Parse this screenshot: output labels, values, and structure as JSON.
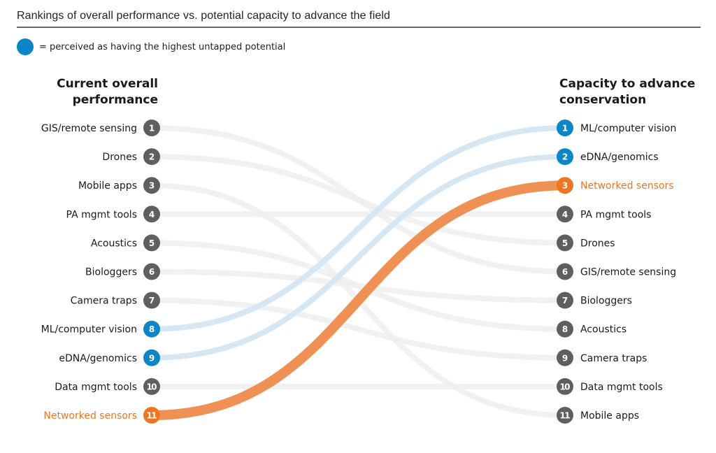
{
  "title": "Rankings of overall performance vs. potential capacity to advance the field",
  "legend": {
    "marker_color": "#0b86c6",
    "text": "= perceived as having the highest untapped potential"
  },
  "colors": {
    "default_node": "#5f5f5f",
    "default_link": "#efefef",
    "highlight_node": "#0b86c6",
    "highlight_link": "#d6e7f3",
    "accent_node": "#ee7623",
    "accent_link": "#ef9155",
    "accent_text": "#ee7623",
    "text": "#1a1a1a"
  },
  "chart_data": {
    "type": "slope",
    "title": "Rankings of overall performance vs. potential capacity to advance the field",
    "left_axis_title": [
      "Current overall",
      "performance"
    ],
    "right_axis_title": [
      "Capacity to advance",
      "conservation"
    ],
    "legend": [
      {
        "marker": "blue circle",
        "label": "= perceived as having the highest untapped potential"
      }
    ],
    "items": [
      {
        "name": "GIS/remote sensing",
        "current_rank": 1,
        "capacity_rank": 6,
        "group": "default"
      },
      {
        "name": "Drones",
        "current_rank": 2,
        "capacity_rank": 5,
        "group": "default"
      },
      {
        "name": "Mobile apps",
        "current_rank": 3,
        "capacity_rank": 11,
        "group": "default"
      },
      {
        "name": "PA mgmt tools",
        "current_rank": 4,
        "capacity_rank": 4,
        "group": "default"
      },
      {
        "name": "Acoustics",
        "current_rank": 5,
        "capacity_rank": 8,
        "group": "default"
      },
      {
        "name": "Biologgers",
        "current_rank": 6,
        "capacity_rank": 7,
        "group": "default"
      },
      {
        "name": "Camera traps",
        "current_rank": 7,
        "capacity_rank": 9,
        "group": "default"
      },
      {
        "name": "ML/computer vision",
        "current_rank": 8,
        "capacity_rank": 1,
        "group": "highlight"
      },
      {
        "name": "eDNA/genomics",
        "current_rank": 9,
        "capacity_rank": 2,
        "group": "highlight"
      },
      {
        "name": "Data mgmt tools",
        "current_rank": 10,
        "capacity_rank": 10,
        "group": "default"
      },
      {
        "name": "Networked sensors",
        "current_rank": 11,
        "capacity_rank": 3,
        "group": "accent"
      }
    ],
    "rank_range": [
      1,
      11
    ]
  }
}
